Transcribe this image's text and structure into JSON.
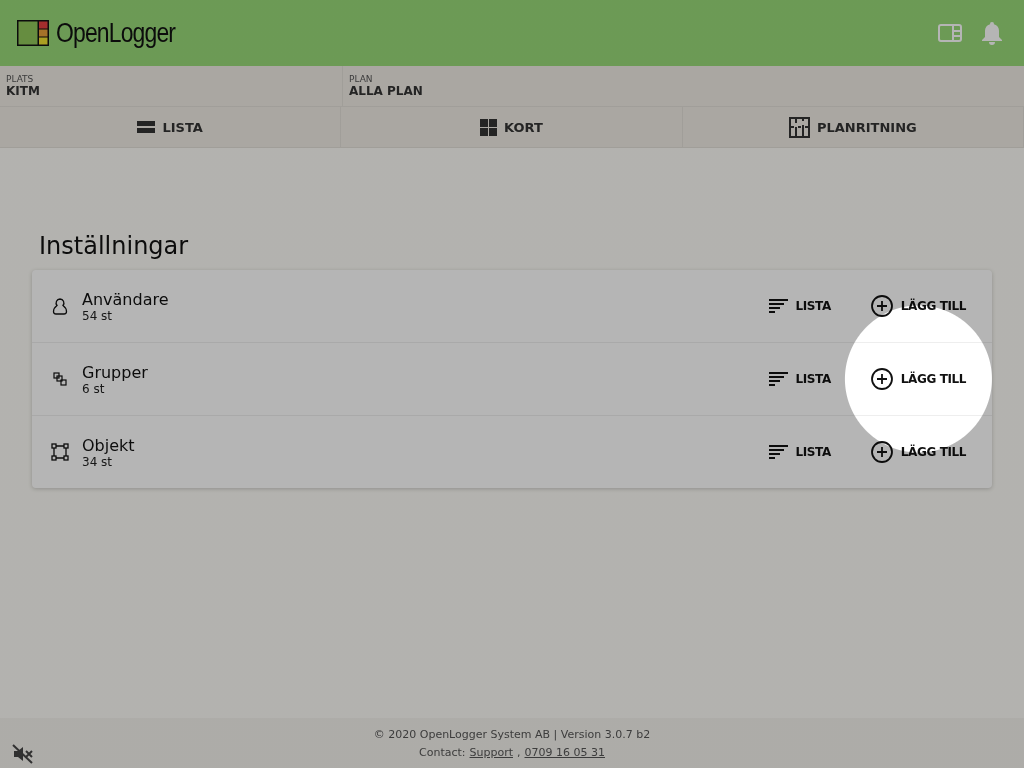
{
  "header": {
    "logo_text": "OpenLogger"
  },
  "location": [
    {
      "label": "PLATS",
      "value": "KITM"
    },
    {
      "label": "PLAN",
      "value": "ALLA PLAN"
    }
  ],
  "view_tabs": [
    {
      "kind": "list",
      "label": "LISTA"
    },
    {
      "kind": "cards",
      "label": "KORT"
    },
    {
      "kind": "floorplan",
      "label": "PLANRITNING"
    }
  ],
  "section_title": "Inställningar",
  "settings": [
    {
      "kind": "user",
      "name": "Användare",
      "count": "54 st",
      "list_label": "LISTA",
      "add_label": "LÄGG TILL",
      "highlighted": false
    },
    {
      "kind": "group",
      "name": "Grupper",
      "count": "6 st",
      "list_label": "LISTA",
      "add_label": "LÄGG TILL",
      "highlighted": true
    },
    {
      "kind": "object",
      "name": "Objekt",
      "count": "34 st",
      "list_label": "LISTA",
      "add_label": "LÄGG TILL",
      "highlighted": false
    }
  ],
  "footer": {
    "copyright": "© 2020 OpenLogger System AB | Version 3.0.7 b2",
    "contact_label": "Contact:",
    "support_link": "Support",
    "separator": ",",
    "phone_link": "0709 16 05 31"
  }
}
